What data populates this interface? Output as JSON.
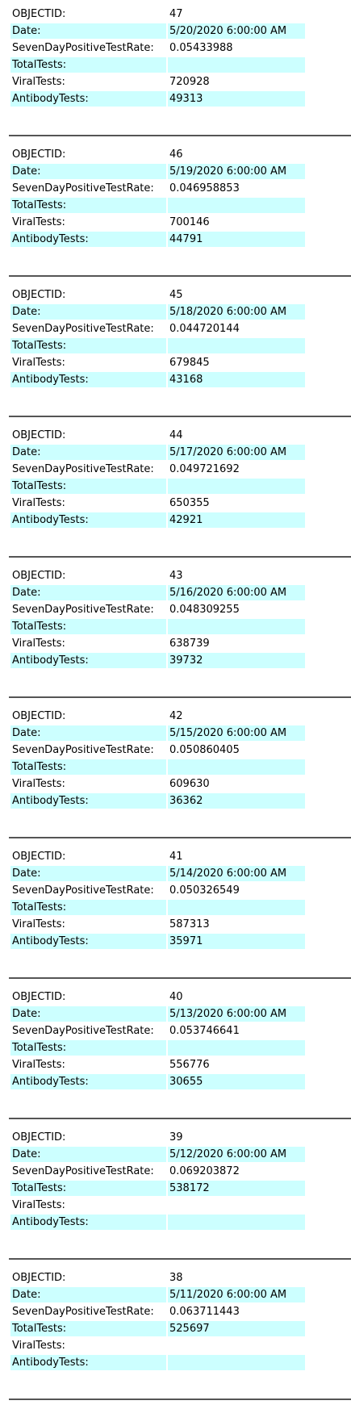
{
  "fields": [
    "OBJECTID:",
    "Date:",
    "SevenDayPositiveTestRate:",
    "TotalTests:",
    "ViralTests:",
    "AntibodyTests:"
  ],
  "colors": {
    "row_highlight": "#ccffff",
    "divider": "#555555",
    "text": "#000000"
  },
  "records": [
    {
      "objectid": "47",
      "date": "5/20/2020 6:00:00 AM",
      "rate": "0.05433988",
      "total": "",
      "viral": "720928",
      "antibody": "49313"
    },
    {
      "objectid": "46",
      "date": "5/19/2020 6:00:00 AM",
      "rate": "0.046958853",
      "total": "",
      "viral": "700146",
      "antibody": "44791"
    },
    {
      "objectid": "45",
      "date": "5/18/2020 6:00:00 AM",
      "rate": "0.044720144",
      "total": "",
      "viral": "679845",
      "antibody": "43168"
    },
    {
      "objectid": "44",
      "date": "5/17/2020 6:00:00 AM",
      "rate": "0.049721692",
      "total": "",
      "viral": "650355",
      "antibody": "42921"
    },
    {
      "objectid": "43",
      "date": "5/16/2020 6:00:00 AM",
      "rate": "0.048309255",
      "total": "",
      "viral": "638739",
      "antibody": "39732"
    },
    {
      "objectid": "42",
      "date": "5/15/2020 6:00:00 AM",
      "rate": "0.050860405",
      "total": "",
      "viral": "609630",
      "antibody": "36362"
    },
    {
      "objectid": "41",
      "date": "5/14/2020 6:00:00 AM",
      "rate": "0.050326549",
      "total": "",
      "viral": "587313",
      "antibody": "35971"
    },
    {
      "objectid": "40",
      "date": "5/13/2020 6:00:00 AM",
      "rate": "0.053746641",
      "total": "",
      "viral": "556776",
      "antibody": "30655"
    },
    {
      "objectid": "39",
      "date": "5/12/2020 6:00:00 AM",
      "rate": "0.069203872",
      "total": "538172",
      "viral": "",
      "antibody": ""
    },
    {
      "objectid": "38",
      "date": "5/11/2020 6:00:00 AM",
      "rate": "0.063711443",
      "total": "525697",
      "viral": "",
      "antibody": ""
    }
  ]
}
